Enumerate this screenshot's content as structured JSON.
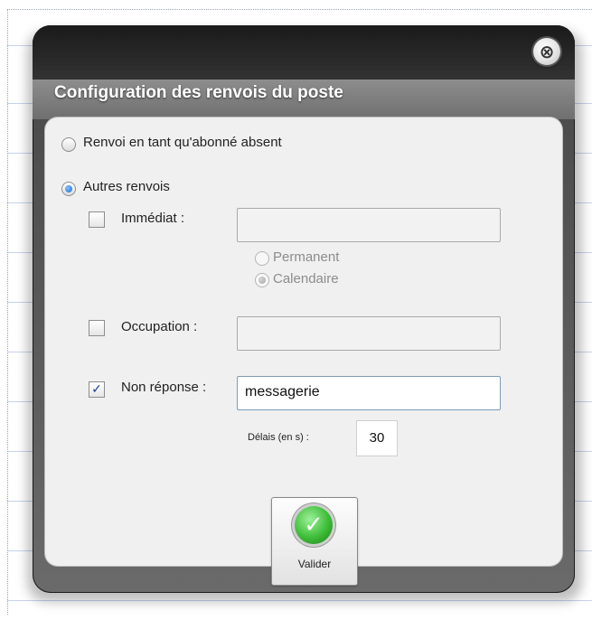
{
  "dialog": {
    "title": "Configuration des renvois du poste",
    "close_symbol": "⊗"
  },
  "options": {
    "absent_label": "Renvoi en tant qu'abonné absent",
    "other_label": "Autres renvois",
    "selected": "other"
  },
  "renvois": {
    "immediat": {
      "label": "Immédiat :",
      "checked": false,
      "value": ""
    },
    "permanent_label": "Permanent",
    "calendaire_label": "Calendaire",
    "occupation": {
      "label": "Occupation :",
      "checked": false,
      "value": ""
    },
    "non_reponse": {
      "label": "Non réponse :",
      "checked": true,
      "value": "messagerie"
    },
    "delais_label": "Délais (en s) :",
    "delais_value": "30"
  },
  "actions": {
    "validate_label": "Valider",
    "validate_icon": "check-icon"
  }
}
